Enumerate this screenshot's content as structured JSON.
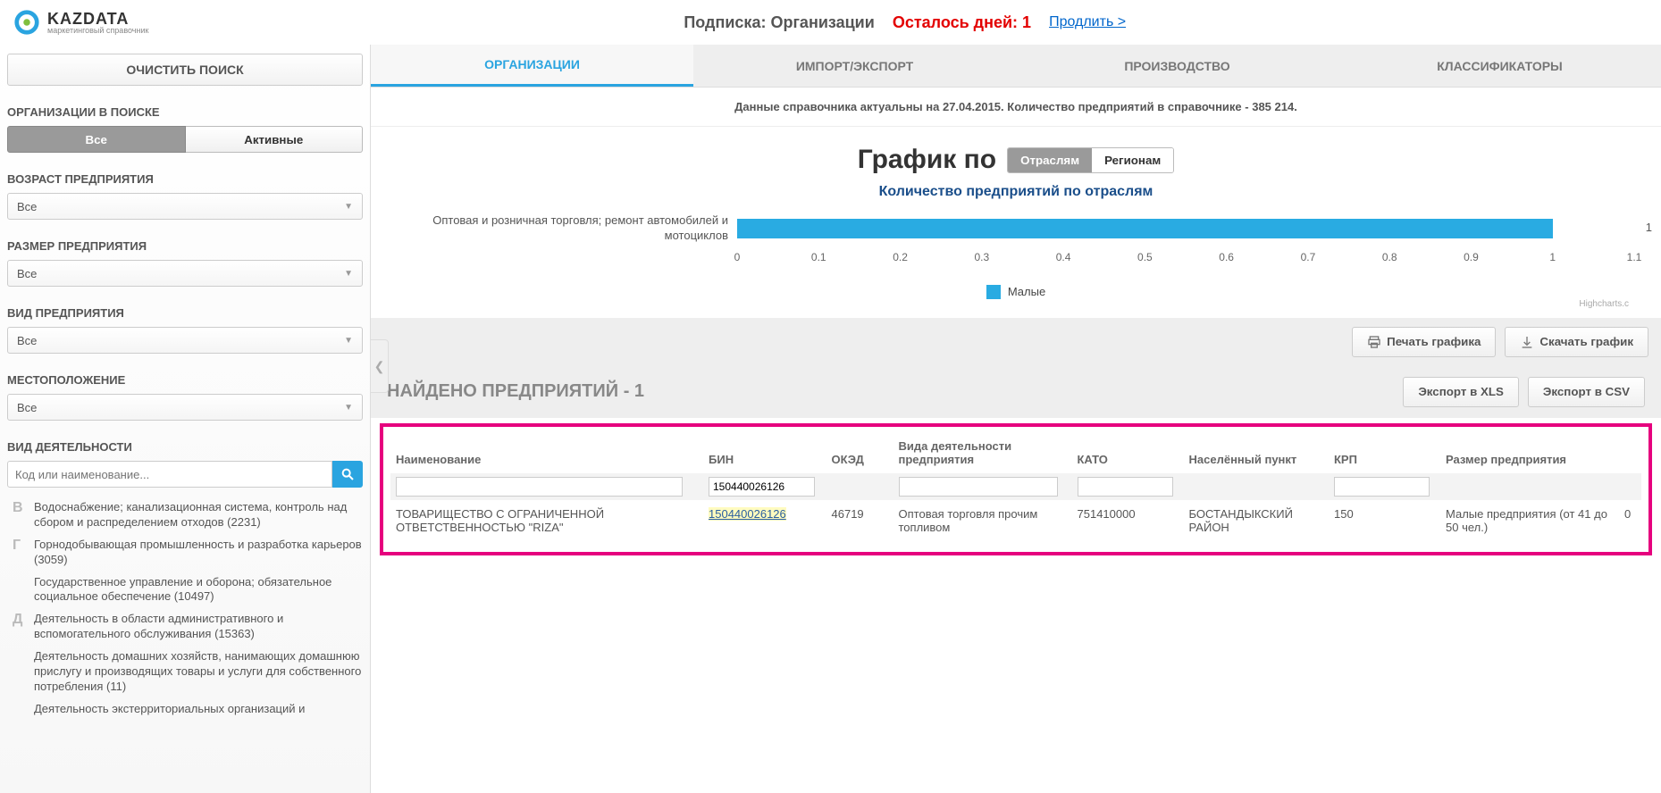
{
  "logo": {
    "main": "KAZDATA",
    "sub": "маркетинговый справочник"
  },
  "header": {
    "subscription_label": "Подписка: Организации",
    "days_left": "Осталось дней: 1",
    "extend": "Продлить >"
  },
  "sidebar": {
    "clear": "ОЧИСТИТЬ ПОИСК",
    "org_in_search": "ОРГАНИЗАЦИИ В ПОИСКЕ",
    "filter_all": "Все",
    "filter_active": "Активные",
    "age_label": "ВОЗРАСТ ПРЕДПРИЯТИЯ",
    "age_value": "Все",
    "size_label": "РАЗМЕР ПРЕДПРИЯТИЯ",
    "size_value": "Все",
    "type_label": "ВИД ПРЕДПРИЯТИЯ",
    "type_value": "Все",
    "loc_label": "МЕСТОПОЛОЖЕНИЕ",
    "loc_value": "Все",
    "activity_label": "ВИД ДЕЯТЕЛЬНОСТИ",
    "search_placeholder": "Код или наименование...",
    "items": [
      {
        "letter": "В",
        "text": "Водоснабжение; канализационная система, контроль над сбором и распределением отходов (2231)"
      },
      {
        "letter": "Г",
        "text": "Горнодобывающая промышленность и разработка карьеров (3059)"
      },
      {
        "letter": "",
        "text": "Государственное управление и оборона; обязательное социальное обеспечение (10497)"
      },
      {
        "letter": "Д",
        "text": "Деятельность в области административного и вспомогательного обслуживания (15363)"
      },
      {
        "letter": "",
        "text": "Деятельность домашних хозяйств, нанимающих домашнюю прислугу и производящих товары и услуги для собственного потребления (11)"
      },
      {
        "letter": "",
        "text": "Деятельность экстерриториальных организаций и"
      }
    ]
  },
  "tabs": {
    "org": "ОРГАНИЗАЦИИ",
    "imp": "ИМПОРТ/ЭКСПОРТ",
    "prod": "ПРОИЗВОДСТВО",
    "class": "КЛАССИФИКАТОРЫ"
  },
  "info_strip": "Данные справочника актуальны на 27.04.2015. Количество предприятий в справочнике - 385 214.",
  "chart": {
    "prefix": "График по",
    "toggle_ind": "Отраслям",
    "toggle_reg": "Регионам",
    "subtitle": "Количество предприятий по отраслям",
    "legend": "Малые",
    "credit": "Highcharts.c"
  },
  "chart_data": {
    "type": "bar",
    "orientation": "horizontal",
    "categories": [
      "Оптовая и розничная торговля; ремонт автомобилей и мотоциклов"
    ],
    "series": [
      {
        "name": "Малые",
        "values": [
          1
        ]
      }
    ],
    "xlim": [
      0,
      1.1
    ],
    "xticks": [
      0,
      0.1,
      0.2,
      0.3,
      0.4,
      0.5,
      0.6,
      0.7,
      0.8,
      0.9,
      1,
      1.1
    ],
    "title": "Количество предприятий по отраслям"
  },
  "toolbar": {
    "print": "Печать графика",
    "download": "Скачать график"
  },
  "results": {
    "heading": "НАЙДЕНО ПРЕДПРИЯТИЙ - 1",
    "export_xls": "Экспорт в XLS",
    "export_csv": "Экспорт в CSV"
  },
  "table": {
    "headers": {
      "name": "Наименование",
      "bin": "БИН",
      "oked": "ОКЭД",
      "activity": "Вида деятельности предприятия",
      "kato": "КАТО",
      "settlement": "Населённый пункт",
      "krp": "КРП",
      "size": "Размер предприятия",
      "extra": ""
    },
    "filter": {
      "bin": "150440026126"
    },
    "rows": [
      {
        "name": "ТОВАРИЩЕСТВО С ОГРАНИЧЕННОЙ ОТВЕТСТВЕННОСТЬЮ \"RIZA\"",
        "bin": "150440026126",
        "oked": "46719",
        "activity": "Оптовая торговля прочим топливом",
        "kato": "751410000",
        "settlement": "БОСТАНДЫКСКИЙ РАЙОН",
        "krp": "150",
        "size": "Малые предприятия (от 41 до 50 чел.)",
        "extra": "0"
      }
    ]
  }
}
